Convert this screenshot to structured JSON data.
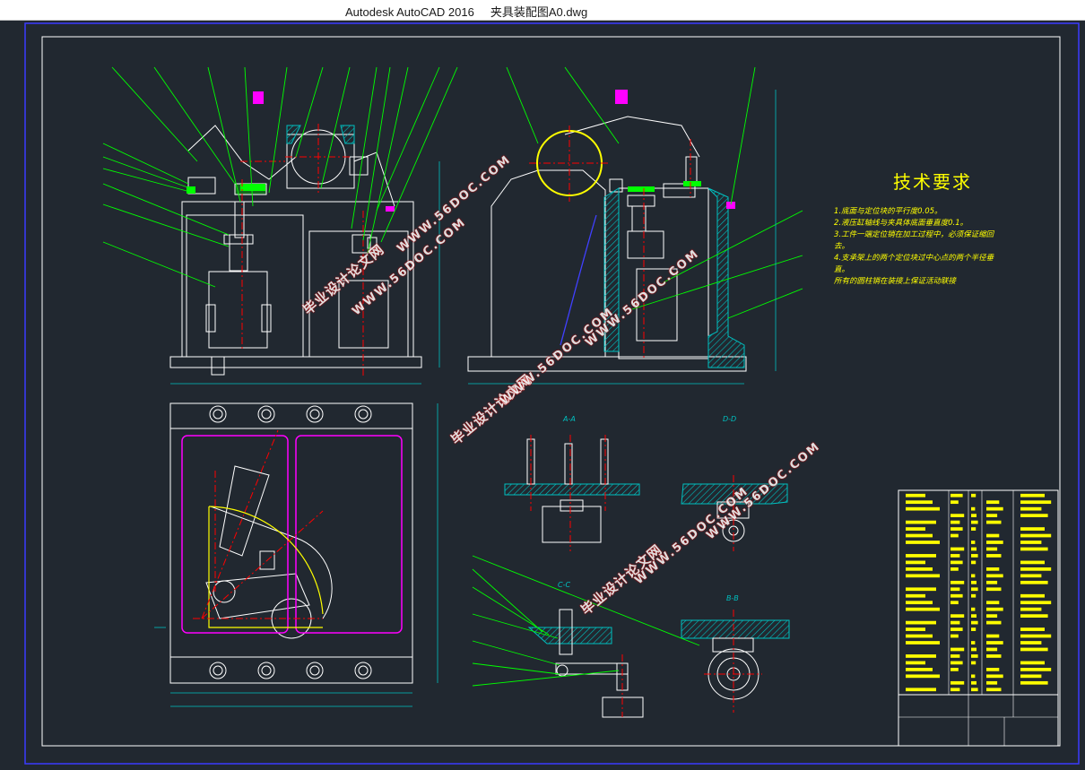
{
  "window": {
    "app_name": "Autodesk AutoCAD 2016",
    "file_name": "夹具装配图A0.dwg"
  },
  "technical_requirements": {
    "title": "技术要求",
    "lines": [
      "1.底面与定位块的平行度0.05。",
      "2.液压缸轴线与夹具体底面垂直度0.1。",
      "3.工件一端定位销在加工过程中，必须保证缩回",
      "   去。",
      "4.支承架上的两个定位块过中心点的两个半径垂",
      "   直。",
      "   所有的圆柱销在装接上保证活动联接"
    ]
  },
  "section_labels": {
    "aa": "A-A",
    "dd": "D-D",
    "cc": "C-C",
    "bb": "B-B"
  },
  "watermarks": {
    "cn": "毕业设计论文网",
    "url": "WWW.56DOC.COM"
  },
  "colors": {
    "background": "#212830",
    "outline": "#ffffff",
    "leader": "#00ff00",
    "centerline": "#ff0000",
    "hatch": "#00c0c0",
    "part_magenta": "#ff00ff",
    "dimension": "#00c0c0",
    "text_yellow": "#ffff00",
    "frame_blue": "#3a3aff"
  }
}
